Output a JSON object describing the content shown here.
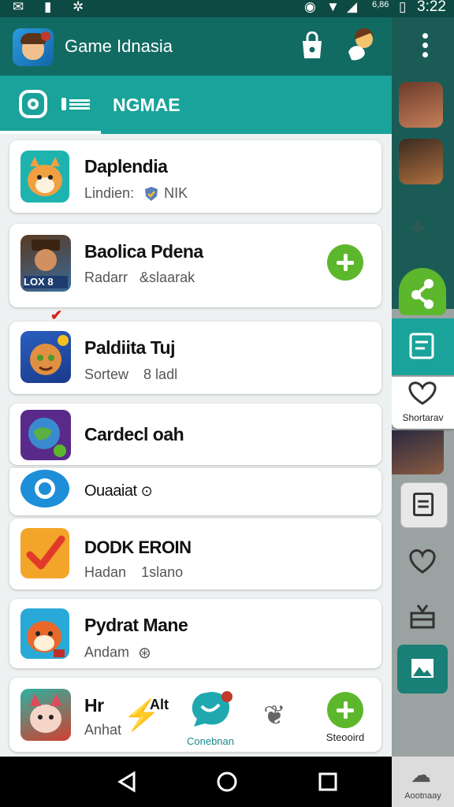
{
  "status": {
    "time": "3:22",
    "small_text": "6,86"
  },
  "header": {
    "title": "Game Idnasia"
  },
  "tabs": {
    "active_label": "NGMAE"
  },
  "items": [
    {
      "title": "Daplendia",
      "subtitle": "Lindien:",
      "meta": "NIK"
    },
    {
      "title": "Baolica Pdena",
      "subtitle": "Radarr",
      "meta": "&slaarak",
      "badge": "LOX 8"
    },
    {
      "title": "Paldiita Tuj",
      "subtitle": "Sortew",
      "meta": "8 ladl"
    },
    {
      "title": "Cardecl oah",
      "subtitle": "",
      "meta": ""
    },
    {
      "title": "Ouaaiat",
      "subtitle": "",
      "meta": ""
    },
    {
      "title": "DODK EROIN",
      "subtitle": "Hadan",
      "meta": "1slano"
    },
    {
      "title": "Pydrat Mane",
      "subtitle": "Andam",
      "meta": ""
    },
    {
      "title": "Hr",
      "subtitle": "Anhat",
      "meta": "Alt"
    }
  ],
  "bottom_actions": {
    "left_label": "Conebnan",
    "right_label": "Steooird"
  },
  "side_panel": {
    "favorite_label": "Shortarav",
    "corner_label": "Aootnaay"
  },
  "colors": {
    "primary": "#126b63",
    "accent": "#1aa39a",
    "green": "#5db72c"
  }
}
